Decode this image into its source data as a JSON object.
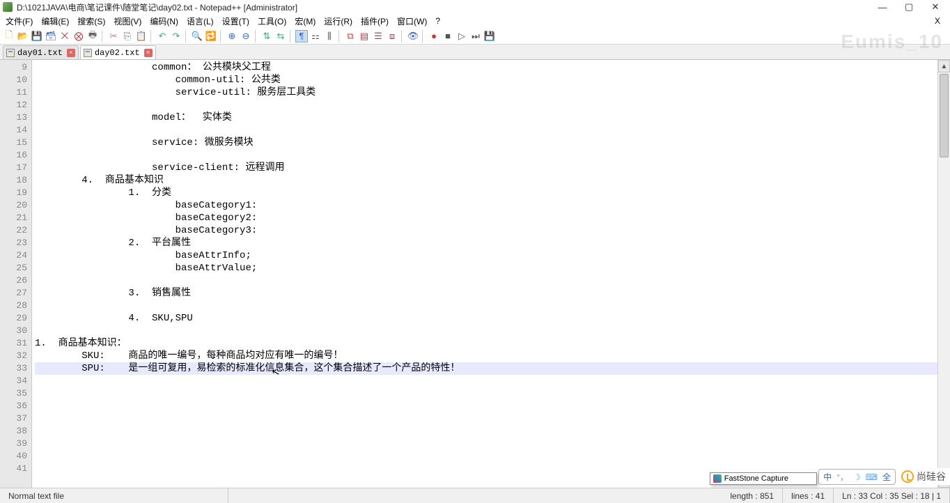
{
  "window": {
    "title": "D:\\1021JAVA\\电商\\笔记课件\\随堂笔记\\day02.txt - Notepad++ [Administrator]"
  },
  "menu": {
    "file": "文件(F)",
    "edit": "编辑(E)",
    "search": "搜索(S)",
    "view": "视图(V)",
    "encoding": "编码(N)",
    "language": "语言(L)",
    "settings": "设置(T)",
    "tools": "工具(O)",
    "macro": "宏(M)",
    "run": "运行(R)",
    "plugins": "插件(P)",
    "windowm": "窗口(W)",
    "help": "?",
    "close": "X"
  },
  "tabs": {
    "t1": "day01.txt",
    "t2": "day02.txt"
  },
  "lines": {
    "start": 9,
    "l9": "                    common： 公共模块父工程",
    "l10": "                        common-util: 公共类",
    "l11": "                        service-util: 服务层工具类",
    "l12": " ",
    "l13": "                    model：  实体类",
    "l14": " ",
    "l15": "                    service: 微服务模块",
    "l16": " ",
    "l17": "                    service-client: 远程调用",
    "l18": "        4.  商品基本知识",
    "l19": "                1.  分类",
    "l20": "                        baseCategory1:",
    "l21": "                        baseCategory2:",
    "l22": "                        baseCategory3:",
    "l23": "                2.  平台属性",
    "l24": "                        baseAttrInfo;",
    "l25": "                        baseAttrValue;",
    "l26": " ",
    "l27": "                3.  销售属性",
    "l28": " ",
    "l29": "                4.  SKU,SPU",
    "l30": " ",
    "l31": "1.  商品基本知识：",
    "l32": "        SKU:    商品的唯一编号，每种商品均对应有唯一的编号！",
    "l33": "        SPU:    是一组可复用，易检索的标准化信息集合，这个集合描述了一个产品的特性！",
    "l34": " ",
    "l35": " ",
    "l36": " ",
    "l37": " ",
    "l38": " ",
    "l39": " ",
    "l40": " ",
    "l41": " "
  },
  "status": {
    "filetype": "Normal text file",
    "length": "length : 851",
    "lines": "lines : 41",
    "pos": "Ln : 33    Col : 35    Sel : 18 | 1"
  },
  "overlay": {
    "faststone": "FastStone Capture",
    "ime_zhong": "中",
    "ime_moon": "☽",
    "ime_key": "⌨",
    "ime_full": "全",
    "brand": "尚硅谷"
  },
  "watermark": "Eumis_10"
}
